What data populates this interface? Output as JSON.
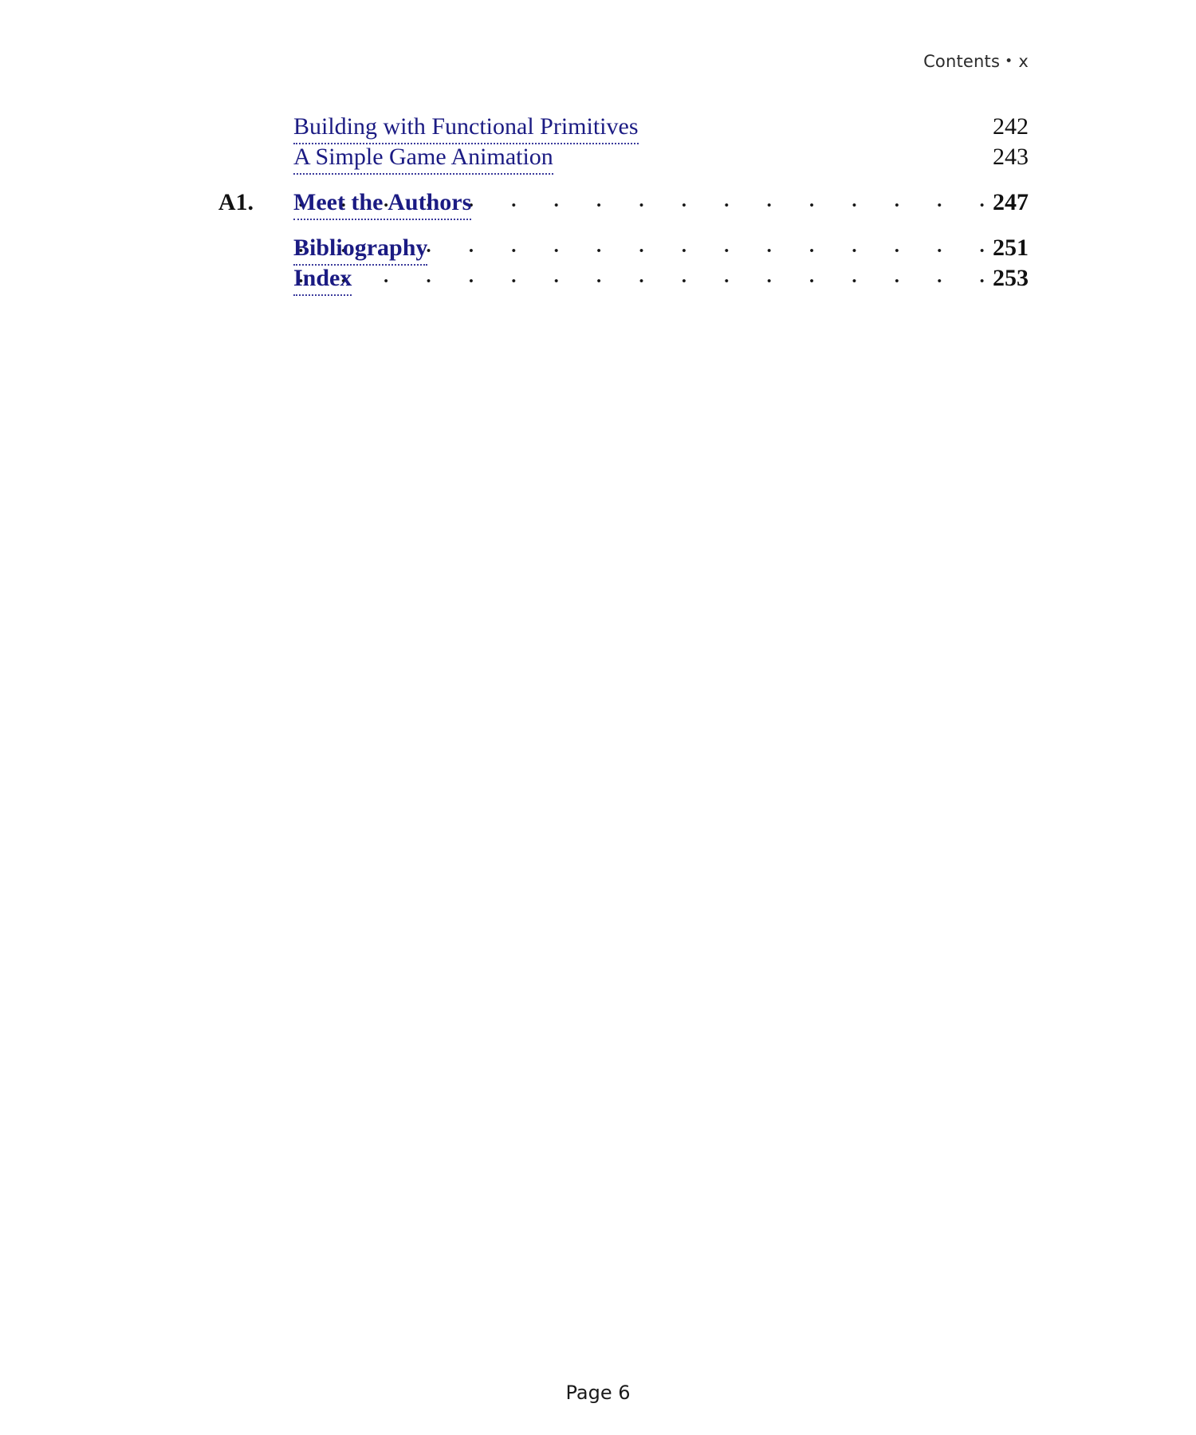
{
  "header": {
    "label": "Contents",
    "separator": "•",
    "folio": "x"
  },
  "toc": {
    "entries": [
      {
        "number": "",
        "title": "Building with Functional Primitives",
        "page": "242",
        "bold": false,
        "leaders": false,
        "gap_before": false
      },
      {
        "number": "",
        "title": "A Simple Game Animation",
        "page": "243",
        "bold": false,
        "leaders": false,
        "gap_before": false
      },
      {
        "number": "A1.",
        "title": "Meet the Authors",
        "page": "247",
        "bold": true,
        "leaders": true,
        "gap_before": true
      },
      {
        "number": "",
        "title": "Bibliography",
        "page": "251",
        "bold": true,
        "leaders": true,
        "gap_before": true
      },
      {
        "number": "",
        "title": "Index",
        "page": "253",
        "bold": true,
        "leaders": true,
        "gap_before": false
      }
    ]
  },
  "footer": {
    "page_label": "Page 6"
  },
  "colors": {
    "link": "#1b1b83",
    "link_underline": "#3b3b9c",
    "text": "#111111",
    "header_text": "#2b2b2b",
    "background": "#ffffff"
  }
}
